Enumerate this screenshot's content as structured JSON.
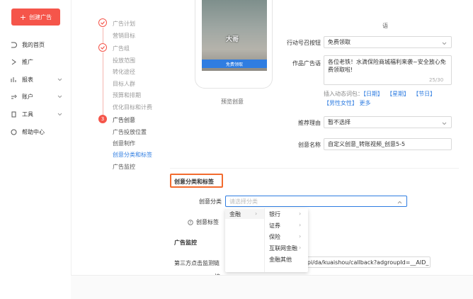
{
  "nav": {
    "create_label": "创建广告",
    "items": [
      {
        "label": "我的首页",
        "icon": "home-icon",
        "has_chevron": false
      },
      {
        "label": "推广",
        "icon": "promo-icon",
        "has_chevron": false
      },
      {
        "label": "报表",
        "icon": "report-icon",
        "has_chevron": true
      },
      {
        "label": "账户",
        "icon": "account-icon",
        "has_chevron": true
      },
      {
        "label": "工具",
        "icon": "tools-icon",
        "has_chevron": true
      },
      {
        "label": "帮助中心",
        "icon": "help-icon",
        "has_chevron": false
      }
    ]
  },
  "steps": {
    "plan_title": "广告计划",
    "plan_subs": [
      "营销目标"
    ],
    "group_title": "广告组",
    "group_subs": [
      "投放范围",
      "转化途径",
      "目标人群",
      "预算和排期",
      "优化目标和计费"
    ],
    "creative_num": "3",
    "creative_title": "广告创意",
    "creative_subs": [
      "广告投放位置",
      "创意制作",
      "创意分类和标签",
      "广告监控"
    ]
  },
  "preview": {
    "overlay_text": "大哥",
    "cta_text": "免费领取",
    "label": "预览创意"
  },
  "form": {
    "top_note": "语",
    "cta_label": "行动号召按钮",
    "cta_value": "免费领取",
    "copy_label": "作品广告语",
    "copy_value": "各位老铁！水滴保险商城福利来袭~安全放心免费领取啦!",
    "copy_count": "25/30",
    "insert_label": "插入动态词包：",
    "words": [
      "【日期】",
      "【星期】",
      "【节日】",
      "【男性女性】"
    ],
    "more": "更多",
    "reason_label": "推荐理由",
    "reason_value": "暂不选择",
    "name_label": "创意名称",
    "name_value": "自定义创意_转账视频_创意5-5"
  },
  "classify": {
    "section_title": "创意分类和标签",
    "category_label": "创意分类",
    "category_placeholder": "请选择分类",
    "tag_label": "创意标签",
    "help_icon": "question-circle-icon"
  },
  "cascader": {
    "level1": [
      "金融"
    ],
    "level2": [
      "银行",
      "证券",
      "保险",
      "互联网金融",
      "金融其他"
    ]
  },
  "monitor": {
    "section_title": "广告监控",
    "third_party_label": "第三方点击监测链",
    "third_party_label2": "接",
    "url_value": "api/da/kuaishou/callback?adgroupId=__AID_"
  },
  "colors": {
    "brand": "#f5554a",
    "link": "#2f7de1",
    "highlight_box": "#f26b2e"
  }
}
